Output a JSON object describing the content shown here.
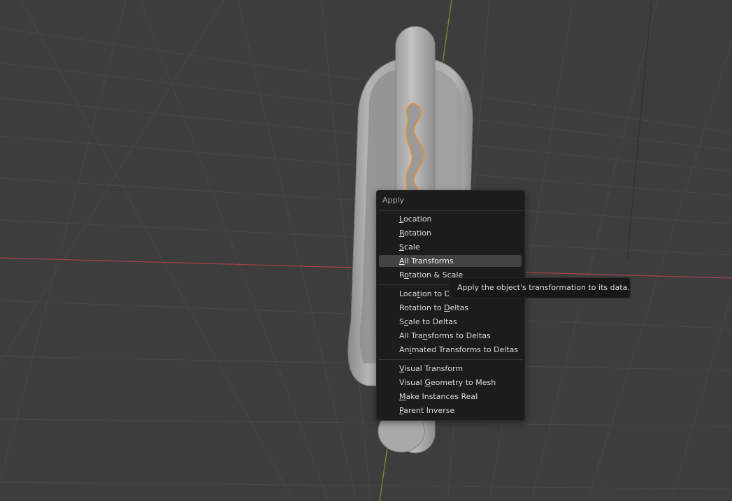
{
  "menu": {
    "title": "Apply",
    "groups": [
      [
        {
          "pre": "",
          "u": "L",
          "post": "ocation"
        },
        {
          "pre": "",
          "u": "R",
          "post": "otation"
        },
        {
          "pre": "",
          "u": "S",
          "post": "cale"
        },
        {
          "pre": "",
          "u": "A",
          "post": "ll Transforms",
          "active": true
        },
        {
          "pre": "R",
          "u": "o",
          "post": "tation & Scale"
        }
      ],
      [
        {
          "pre": "Loca",
          "u": "t",
          "post": "ion to Deltas"
        },
        {
          "pre": "Rotation to ",
          "u": "D",
          "post": "eltas"
        },
        {
          "pre": "S",
          "u": "c",
          "post": "ale to Deltas"
        },
        {
          "pre": "All Tra",
          "u": "n",
          "post": "sforms to Deltas"
        },
        {
          "pre": "An",
          "u": "i",
          "post": "mated Transforms to Deltas"
        }
      ],
      [
        {
          "pre": "",
          "u": "V",
          "post": "isual Transform"
        },
        {
          "pre": "Visual ",
          "u": "G",
          "post": "eometry to Mesh"
        },
        {
          "pre": "",
          "u": "M",
          "post": "ake Instances Real"
        },
        {
          "pre": "",
          "u": "P",
          "post": "arent Inverse"
        }
      ]
    ]
  },
  "tooltip": {
    "text": "Apply the object's transformation to its data."
  },
  "colors": {
    "background": "#3d3d3d",
    "grid": "#474747",
    "x_axis": "#a8424f",
    "y_axis": "#6e9a2c",
    "selection_outline": "#e8912d",
    "mesh": "#a6a6a6"
  }
}
